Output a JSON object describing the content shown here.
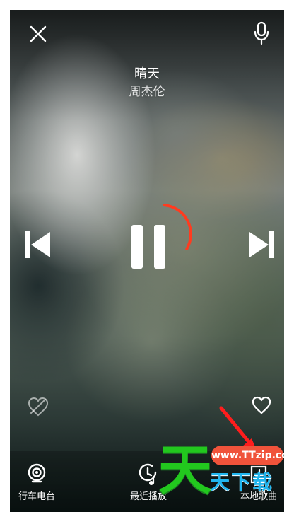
{
  "player": {
    "song_title": "晴天",
    "artist": "周杰伦",
    "progress": 0.32
  },
  "icons": {
    "close": "close-icon",
    "microphone": "microphone-icon",
    "previous": "previous-track-icon",
    "pause": "pause-icon",
    "next": "next-track-icon",
    "dislike": "broken-heart-icon",
    "like": "heart-icon",
    "radio": "radio-icon",
    "recent": "recent-play-icon",
    "local_music": "local-music-icon",
    "annotation_arrow": "red-arrow"
  },
  "bottom_nav": {
    "items": [
      {
        "label": "行车电台"
      },
      {
        "label": "最近播放"
      },
      {
        "label": "本地歌曲"
      }
    ]
  },
  "watermark": {
    "badge": "www.TTzip.com",
    "big": "天",
    "small": "天下载"
  },
  "colors": {
    "progress": "#ff3b1f",
    "watermark_green": "#22c81e",
    "watermark_blue": "#20b6ef",
    "watermark_badge": "#f0533b",
    "annotation": "#ff1d1d"
  }
}
